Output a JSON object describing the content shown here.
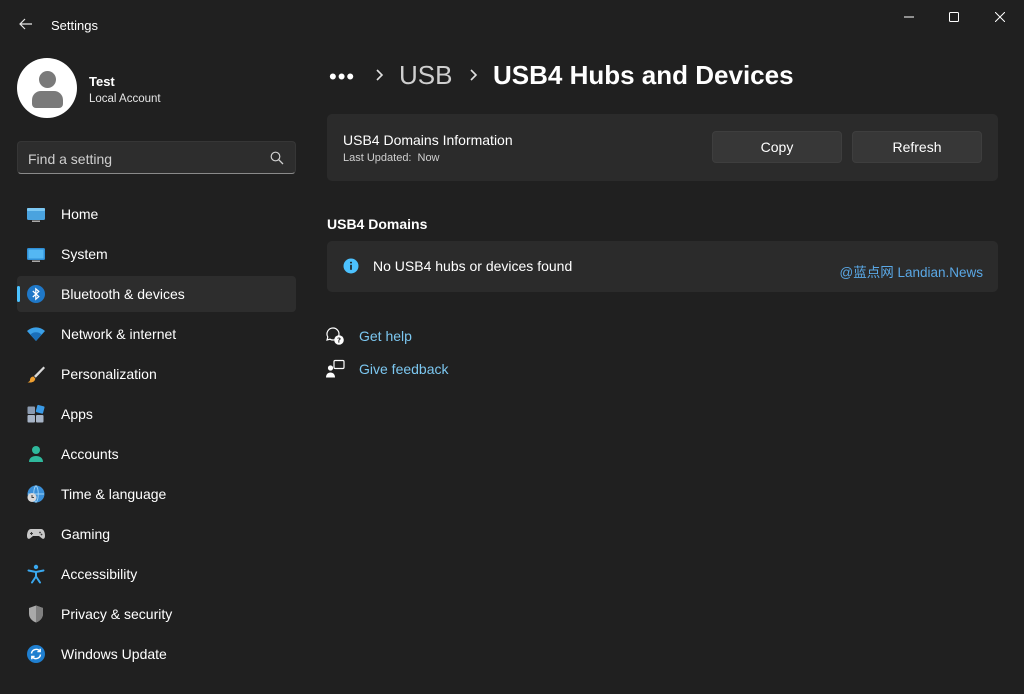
{
  "window": {
    "title": "Settings",
    "controls": [
      "minimize",
      "maximize",
      "close"
    ]
  },
  "profile": {
    "name": "Test",
    "account_type": "Local Account"
  },
  "search": {
    "placeholder": "Find a setting"
  },
  "sidebar": {
    "items": [
      {
        "label": "Home",
        "icon": "home-icon"
      },
      {
        "label": "System",
        "icon": "system-icon"
      },
      {
        "label": "Bluetooth & devices",
        "icon": "bluetooth-icon",
        "active": true
      },
      {
        "label": "Network & internet",
        "icon": "wifi-icon"
      },
      {
        "label": "Personalization",
        "icon": "brush-icon"
      },
      {
        "label": "Apps",
        "icon": "apps-icon"
      },
      {
        "label": "Accounts",
        "icon": "accounts-icon"
      },
      {
        "label": "Time & language",
        "icon": "globe-clock-icon"
      },
      {
        "label": "Gaming",
        "icon": "gamepad-icon"
      },
      {
        "label": "Accessibility",
        "icon": "accessibility-icon"
      },
      {
        "label": "Privacy & security",
        "icon": "shield-icon"
      },
      {
        "label": "Windows Update",
        "icon": "update-icon"
      }
    ]
  },
  "breadcrumb": {
    "overflow": "•••",
    "parent": "USB",
    "current": "USB4 Hubs and Devices"
  },
  "info_card": {
    "title": "USB4 Domains Information",
    "last_updated_label": "Last Updated:",
    "last_updated_value": "Now",
    "copy_label": "Copy",
    "refresh_label": "Refresh"
  },
  "domains": {
    "heading": "USB4 Domains",
    "empty_message": "No USB4 hubs or devices found",
    "watermark": "@蓝点网 Landian.News"
  },
  "help_links": {
    "get_help": "Get help",
    "give_feedback": "Give feedback"
  },
  "colors": {
    "accent": "#4cc2ff",
    "link": "#7cc7f0",
    "background": "#202020",
    "card": "#2b2b2b"
  }
}
